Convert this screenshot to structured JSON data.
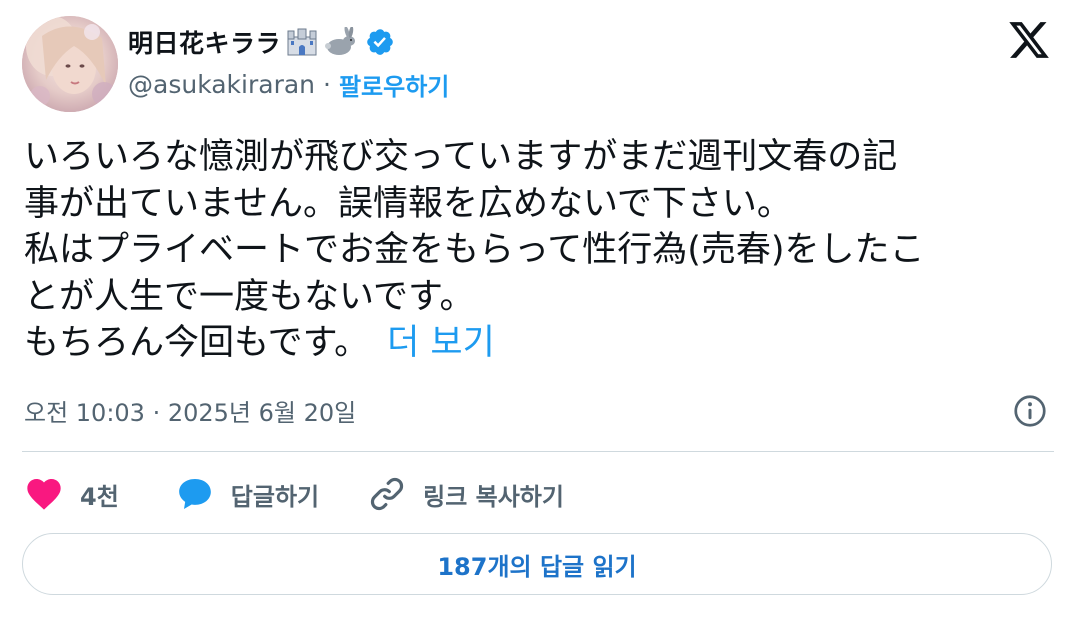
{
  "author": {
    "display_name": "明日花キララ",
    "name_emoji": [
      "castle-emoji",
      "rabbit-emoji"
    ],
    "handle": "@asukakiraran",
    "separator": "·",
    "follow_label": "팔로우하기",
    "verified": true
  },
  "tweet": {
    "lines": [
      "いろいろな憶測が飛び交っていますがまだ週刊文春の記",
      "事が出ていません。誤情報を広めないで下さい。",
      "私はプライベートでお金をもらって性行為(売春)をしたこ",
      "とが人生で一度もないです。",
      "もちろん今回もです。"
    ],
    "show_more_label": "더 보기"
  },
  "meta": {
    "timestamp": "오전 10:03 · 2025년 6월 20일",
    "info_icon": "info-icon"
  },
  "actions": {
    "like_count": "4천",
    "reply_label": "답글하기",
    "copy_link_label": "링크 복사하기"
  },
  "replies_button_label": "187개의 답글 읽기",
  "colors": {
    "accent": "#1d9bf0",
    "like": "#f91880",
    "text": "#0f1419",
    "muted": "#536471",
    "border": "#cfd9de"
  }
}
